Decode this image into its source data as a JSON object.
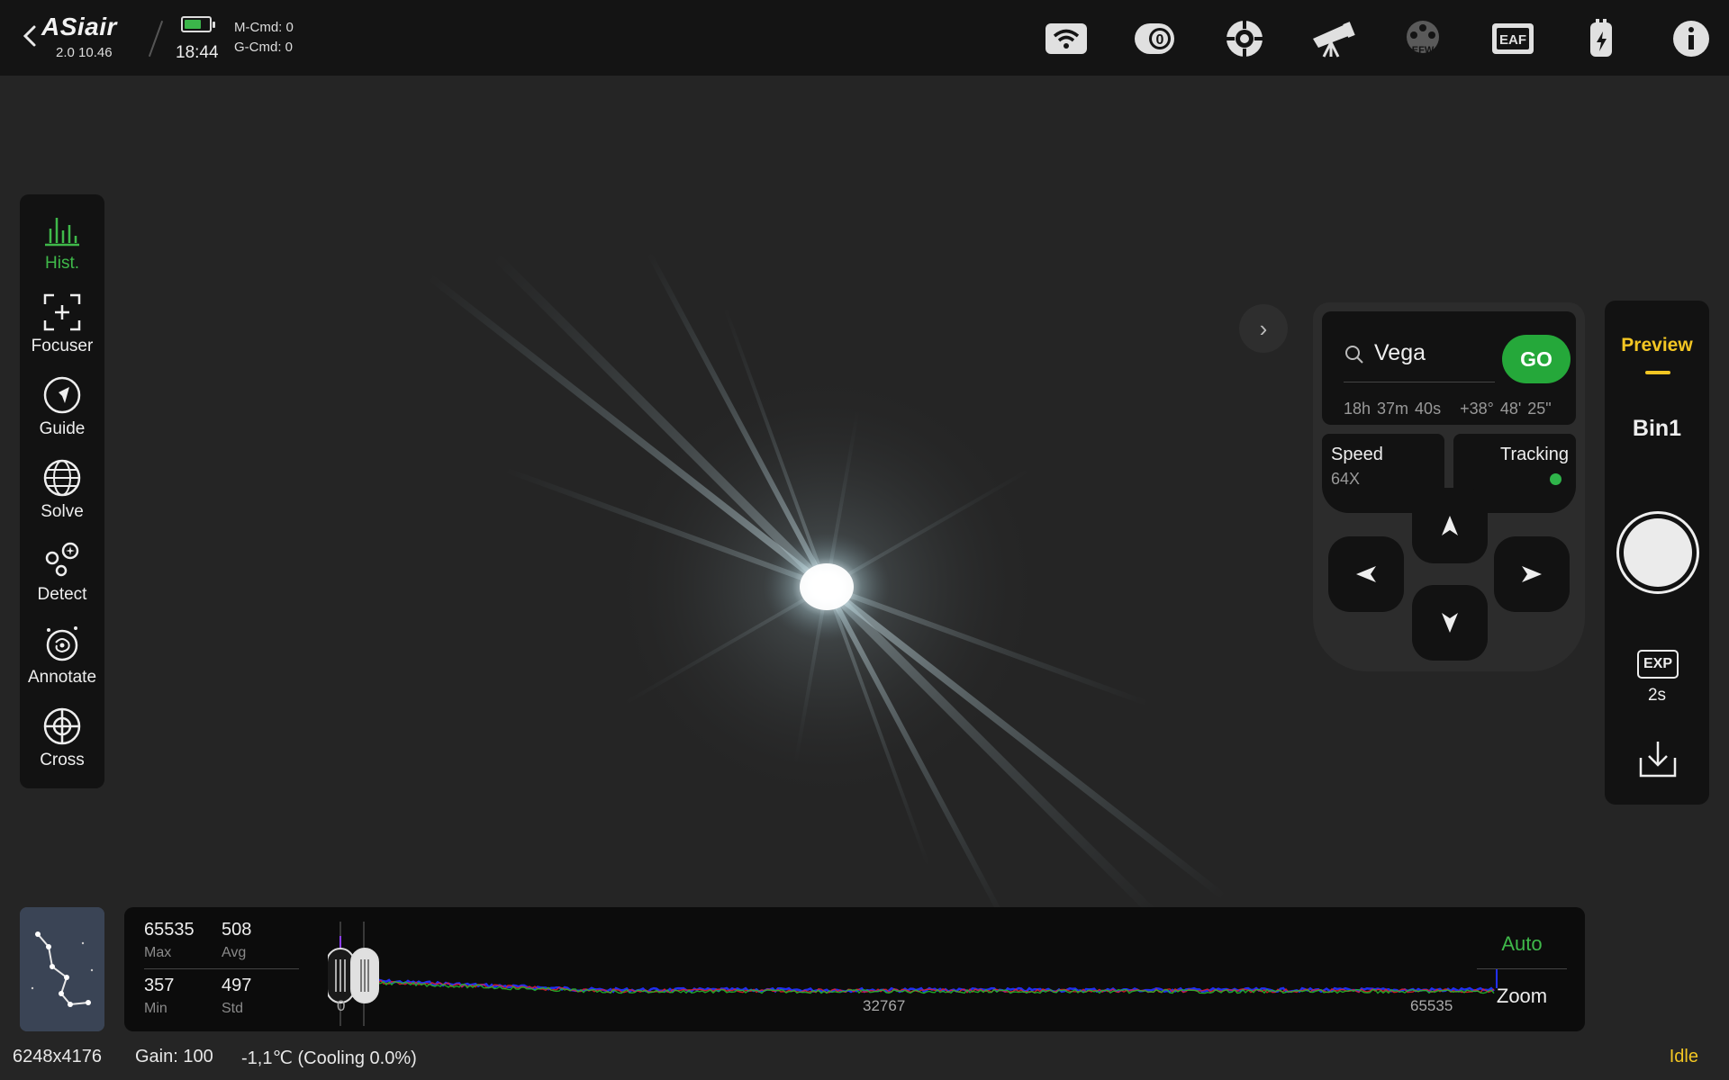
{
  "app": {
    "logo": "ASiair",
    "version": "2.0 10.46",
    "time": "18:44",
    "m_cmd": "M-Cmd: 0",
    "g_cmd": "G-Cmd: 0",
    "battery_level": 0.7
  },
  "top_icons": [
    "wifi-icon",
    "camera-icon",
    "guide-camera-icon",
    "telescope-icon",
    "efw-icon",
    "eaf-icon",
    "power-bank-icon",
    "info-icon"
  ],
  "top_icon_labels": {
    "efw": "EFW",
    "eaf": "EAF"
  },
  "left_tools": [
    {
      "label": "Hist.",
      "icon": "histogram-icon",
      "active": true
    },
    {
      "label": "Focuser",
      "icon": "focuser-icon",
      "active": false
    },
    {
      "label": "Guide",
      "icon": "guide-icon",
      "active": false
    },
    {
      "label": "Solve",
      "icon": "globe-icon",
      "active": false
    },
    {
      "label": "Detect",
      "icon": "detect-icon",
      "active": false
    },
    {
      "label": "Annotate",
      "icon": "galaxy-icon",
      "active": false
    },
    {
      "label": "Cross",
      "icon": "crosshair-icon",
      "active": false
    }
  ],
  "goto": {
    "target": "Vega",
    "go_label": "GO",
    "ra": "18h 37m 40s",
    "dec": "+38° 48' 25\"",
    "speed_label": "Speed",
    "speed_value": "64X",
    "tracking_label": "Tracking",
    "tracking_on": true
  },
  "right_panel": {
    "mode": "Preview",
    "bin": "Bin1",
    "exp_badge": "EXP",
    "exposure": "2s"
  },
  "histogram": {
    "max_value": "65535",
    "max_label": "Max",
    "avg_value": "508",
    "avg_label": "Avg",
    "min_value": "357",
    "min_label": "Min",
    "std_value": "497",
    "std_label": "Std",
    "axis_labels": [
      "0",
      "32767",
      "65535"
    ],
    "auto_label": "Auto",
    "zoom_label": "Zoom",
    "colors": {
      "red": "#e8202a",
      "green": "#22c02a",
      "blue": "#2230ff"
    }
  },
  "status": {
    "resolution": "6248x4176",
    "gain": "Gain: 100",
    "temperature": "-1,1℃ (Cooling 0.0%)",
    "state": "Idle"
  },
  "colors": {
    "accent_green": "#3fb94a",
    "accent_yellow": "#f3c623",
    "go_green": "#25a83a"
  }
}
